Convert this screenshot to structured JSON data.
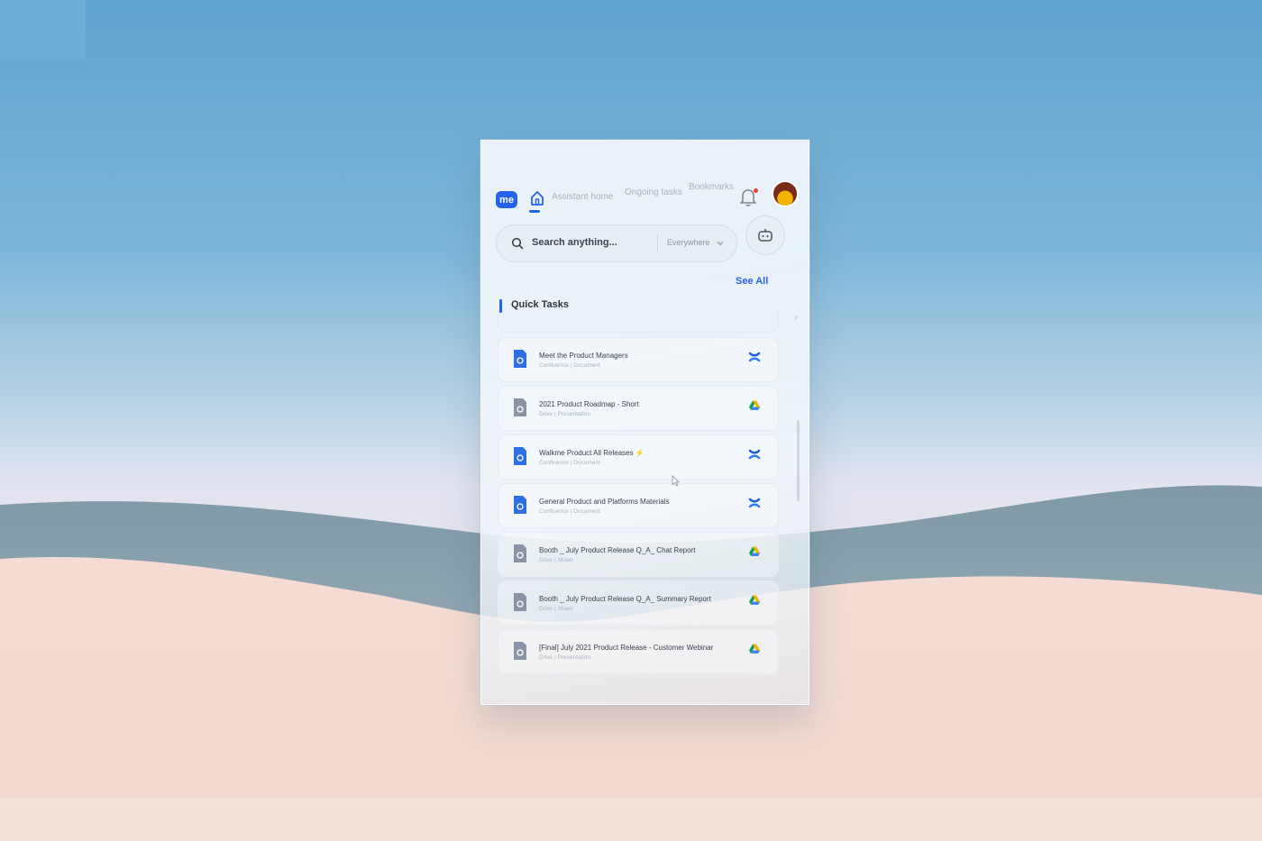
{
  "app": {
    "logo_text": "me"
  },
  "nav": {
    "items": [
      {
        "label": "Assistant home",
        "icon": "home-icon",
        "active": true
      },
      {
        "label": "Ongoing tasks",
        "active": false
      },
      {
        "label": "Bookmarks",
        "active": false
      }
    ]
  },
  "header": {
    "notification_icon": "bell-icon",
    "has_unread": true,
    "avatar": "user-avatar"
  },
  "search": {
    "placeholder": "Search anything...",
    "scope": "Everywhere"
  },
  "assistant_button": {
    "icon": "bot-icon"
  },
  "quick_tasks": {
    "title": "Quick Tasks",
    "see_all": "See All",
    "items": [
      {
        "title": "Meet the Product Managers",
        "subtitle": "Confluence | Document",
        "doc_color": "#2f6fe4",
        "source": "confluence-icon"
      },
      {
        "title": "2021 Product Roadmap - Short",
        "subtitle": "Drive | Presentation",
        "doc_color": "#8b94a6",
        "source": "google-drive-icon"
      },
      {
        "title": "Walkme Product All Releases ⚡",
        "subtitle": "Confluence | Document",
        "doc_color": "#2f6fe4",
        "source": "confluence-icon"
      },
      {
        "title": "General Product and Platforms Materials",
        "subtitle": "Confluence | Document",
        "doc_color": "#2f6fe4",
        "source": "confluence-icon"
      },
      {
        "title": "Booth _ July Product Release Q_A_ Chat Report",
        "subtitle": "Drive | Sheet",
        "doc_color": "#8b94a6",
        "source": "google-drive-icon"
      },
      {
        "title": "Booth _ July Product Release Q_A_ Summary Report",
        "subtitle": "Drive | Sheet",
        "doc_color": "#8b94a6",
        "source": "google-drive-icon"
      },
      {
        "title": "[Final] July 2021 Product Release - Customer Webinar",
        "subtitle": "Drive | Presentation",
        "doc_color": "#8b94a6",
        "source": "google-drive-icon"
      }
    ]
  },
  "colors": {
    "accent": "#2563eb",
    "sky": "#5fa3cf",
    "sand": "#f0d8d0",
    "dune": "#6f8b98"
  }
}
